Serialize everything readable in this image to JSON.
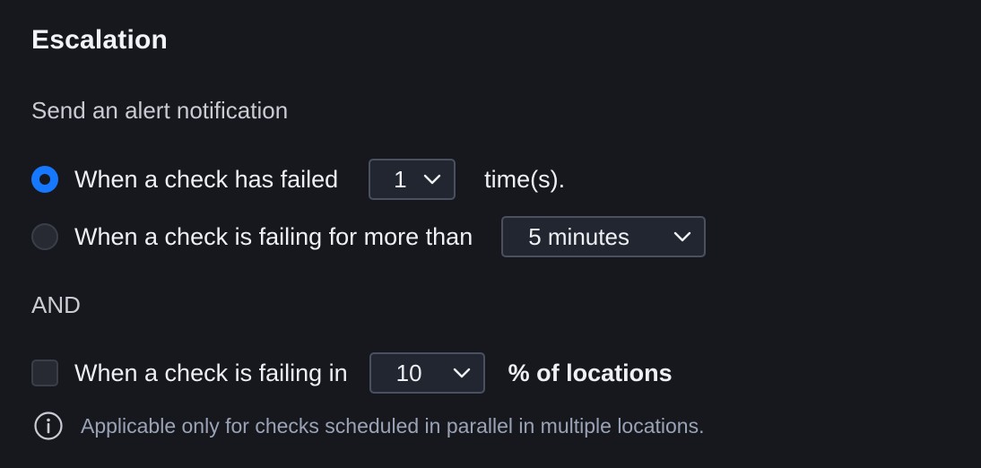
{
  "section": {
    "title": "Escalation",
    "subtitle": "Send an alert notification"
  },
  "options": {
    "failed_count": {
      "label": "When a check has failed",
      "selected": true,
      "select_value": "1",
      "suffix": "time(s)."
    },
    "failing_duration": {
      "label": "When a check is failing for more than",
      "selected": false,
      "select_value": "5 minutes"
    }
  },
  "conjunction": "AND",
  "locations": {
    "label": "When a check is failing in",
    "checked": false,
    "select_value": "10",
    "suffix": "% of locations"
  },
  "hint": {
    "icon": "info-icon",
    "text": "Applicable only for checks scheduled in parallel in multiple locations."
  },
  "colors": {
    "background": "#17181d",
    "accent": "#1677ff",
    "muted_text": "#9aa3b6"
  }
}
